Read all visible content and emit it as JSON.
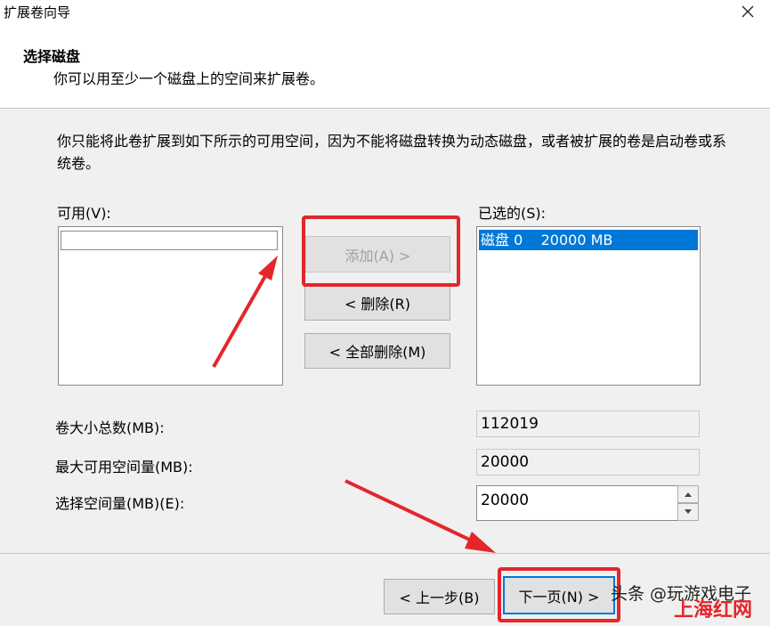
{
  "window": {
    "title": "扩展卷向导"
  },
  "header": {
    "title": "选择磁盘",
    "subtitle": "你可以用至少一个磁盘上的空间来扩展卷。"
  },
  "description": "你只能将此卷扩展到如下所示的可用空间，因为不能将磁盘转换为动态磁盘，或者被扩展的卷是启动卷或系统卷。",
  "available": {
    "label": "可用(V):",
    "items": []
  },
  "selected": {
    "label": "已选的(S):",
    "items": [
      {
        "text": "磁盘 0    20000 MB"
      }
    ]
  },
  "buttons": {
    "add": "添加(A) >",
    "remove": "< 删除(R)",
    "remove_all": "< 全部删除(M)",
    "back": "< 上一步(B)",
    "next": "下一页(N) >"
  },
  "fields": {
    "total_label": "卷大小总数(MB):",
    "total_value": "112019",
    "max_label": "最大可用空间量(MB):",
    "max_value": "20000",
    "select_label": "选择空间量(MB)(E):",
    "select_value": "20000"
  },
  "watermark": {
    "line1": "头条 @玩游戏电子",
    "line2": "上海红网"
  },
  "colors": {
    "highlight": "#e3262a",
    "selection": "#0078d7"
  }
}
